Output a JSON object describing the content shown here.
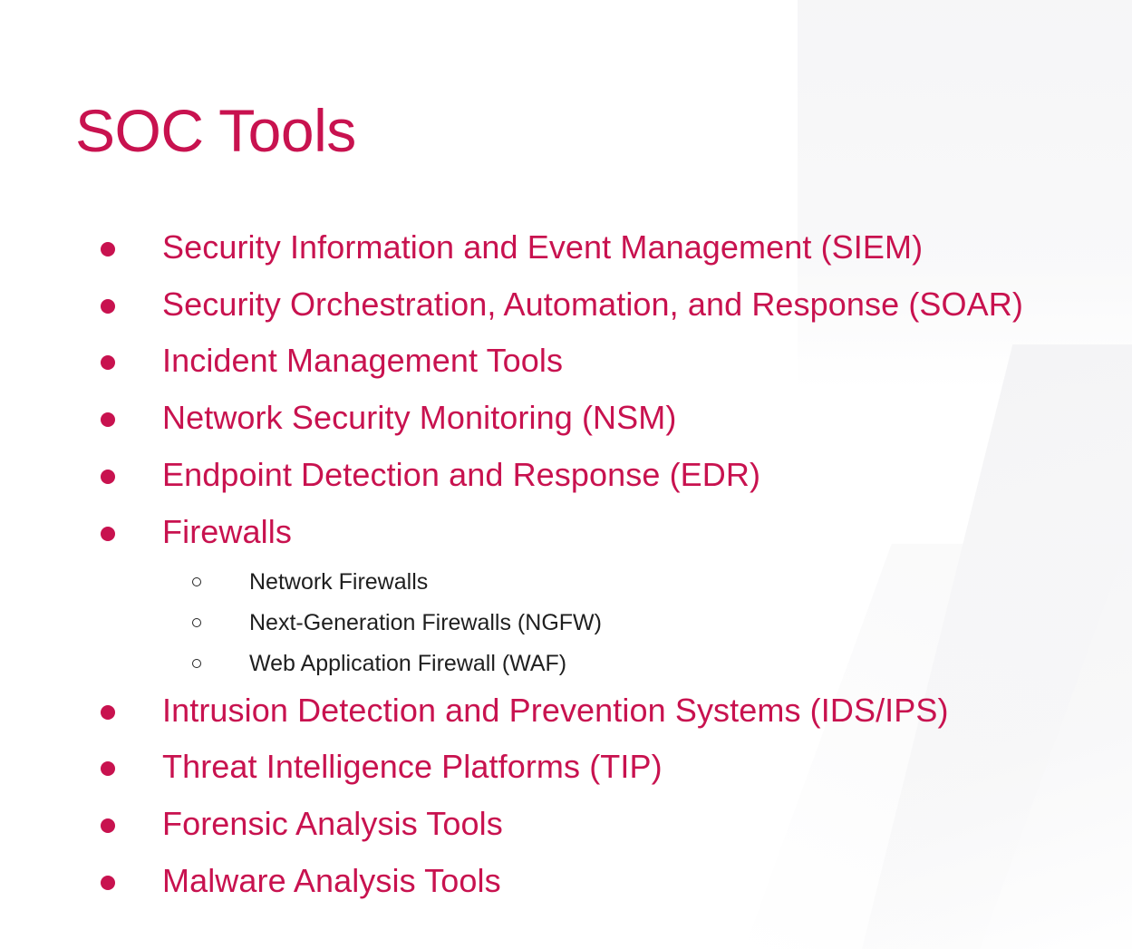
{
  "slide": {
    "title": "SOC Tools",
    "accent_color": "#c8124f",
    "items": [
      {
        "label": "Security Information and Event Management (SIEM)"
      },
      {
        "label": "Security Orchestration, Automation, and Response (SOAR)"
      },
      {
        "label": "Incident Management Tools"
      },
      {
        "label": "Network Security Monitoring (NSM)"
      },
      {
        "label": "Endpoint Detection and Response (EDR)"
      },
      {
        "label": "Firewalls",
        "subitems": [
          {
            "label": "Network Firewalls"
          },
          {
            "label": "Next-Generation Firewalls (NGFW)"
          },
          {
            "label": "Web Application Firewall (WAF)"
          }
        ]
      },
      {
        "label": "Intrusion Detection and Prevention Systems (IDS/IPS)"
      },
      {
        "label": "Threat Intelligence Platforms (TIP)"
      },
      {
        "label": "Forensic Analysis Tools"
      },
      {
        "label": "Malware Analysis Tools"
      }
    ]
  }
}
